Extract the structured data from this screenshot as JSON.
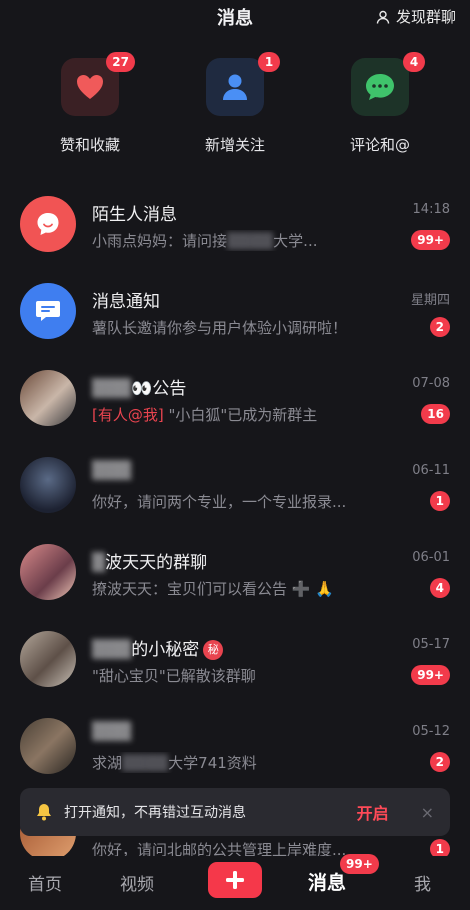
{
  "header": {
    "title": "消息",
    "discover_label": "发现群聊"
  },
  "quick_actions": [
    {
      "label": "赞和收藏",
      "badge": "27",
      "icon": "heart-icon",
      "bg": "#3a2024",
      "color": "#f05a5a"
    },
    {
      "label": "新增关注",
      "badge": "1",
      "icon": "person-icon",
      "bg": "#1f2a40",
      "color": "#4a8ff5"
    },
    {
      "label": "评论和@",
      "badge": "4",
      "icon": "comment-icon",
      "bg": "#1d3328",
      "color": "#3fc36b"
    }
  ],
  "messages": [
    {
      "name": "陌生人消息",
      "preview": "小雨点妈妈：请问接",
      "preview_tail": "大学...",
      "time": "14:18",
      "count": "99+"
    },
    {
      "name": "消息通知",
      "preview": "薯队长邀请你参与用户体验小调研啦！",
      "time": "星期四",
      "count": "2"
    },
    {
      "name": "👀公告",
      "preview_at": "[有人@我]",
      "preview": " \"小白狐\"已成为新群主",
      "time": "07-08",
      "count": "16"
    },
    {
      "name": "",
      "preview": "你好，请问两个专业，一个专业报录...",
      "time": "06-11",
      "count": "1"
    },
    {
      "name": "波天天的群聊",
      "preview": "撩波天天：宝贝们可以看公告 ➕ 🙏",
      "time": "06-01",
      "count": "4"
    },
    {
      "name": "的小秘密",
      "tag": "秘",
      "preview": "\"甜心宝贝\"已解散该群聊",
      "time": "05-17",
      "count": "99+"
    },
    {
      "name": "",
      "preview": "求湖",
      "preview_tail": "大学741资料",
      "time": "05-12",
      "count": "2"
    },
    {
      "name": "",
      "preview": "你好，请问北邮的公共管理上岸难度...",
      "time": "",
      "count": "1"
    }
  ],
  "notice": {
    "text": "打开通知，不再错过互动消息",
    "action": "开启",
    "close": "×"
  },
  "tabbar": {
    "home": "首页",
    "video": "视频",
    "messages": "消息",
    "messages_badge": "99+",
    "me": "我"
  }
}
